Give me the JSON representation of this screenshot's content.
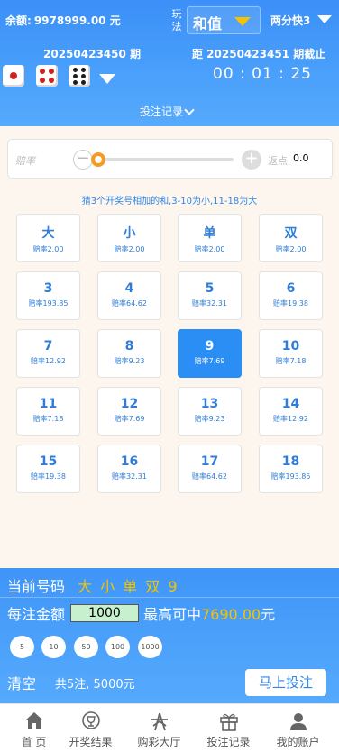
{
  "header": {
    "balance_label": "余额:",
    "balance_value": "9978999.00 元",
    "play_label": "玩法",
    "play_mode": "和值",
    "lottery_name": "两分快3",
    "current_period": "20250423450 期",
    "next_period_label": "距 20250423451 期截止",
    "countdown": "00 : 01 : 25",
    "dice": [
      1,
      4,
      6
    ],
    "record_button": "投注记录"
  },
  "rate_bar": {
    "rate_label": "赔率",
    "rebate_label": "返点",
    "rebate_value": "0.0",
    "minus": "−",
    "plus": "+"
  },
  "hint": "猜3个开奖号相加的和,3-10为小,11-18为大",
  "options": [
    {
      "name": "大",
      "odds": "赔率2.00",
      "selected": false
    },
    {
      "name": "小",
      "odds": "赔率2.00",
      "selected": false
    },
    {
      "name": "单",
      "odds": "赔率2.00",
      "selected": false
    },
    {
      "name": "双",
      "odds": "赔率2.00",
      "selected": false
    },
    {
      "name": "3",
      "odds": "赔率193.85",
      "selected": false
    },
    {
      "name": "4",
      "odds": "赔率64.62",
      "selected": false
    },
    {
      "name": "5",
      "odds": "赔率32.31",
      "selected": false
    },
    {
      "name": "6",
      "odds": "赔率19.38",
      "selected": false
    },
    {
      "name": "7",
      "odds": "赔率12.92",
      "selected": false
    },
    {
      "name": "8",
      "odds": "赔率9.23",
      "selected": false
    },
    {
      "name": "9",
      "odds": "赔率7.69",
      "selected": true
    },
    {
      "name": "10",
      "odds": "赔率7.18",
      "selected": false
    },
    {
      "name": "11",
      "odds": "赔率7.18",
      "selected": false
    },
    {
      "name": "12",
      "odds": "赔率7.69",
      "selected": false
    },
    {
      "name": "13",
      "odds": "赔率9.23",
      "selected": false
    },
    {
      "name": "14",
      "odds": "赔率12.92",
      "selected": false
    },
    {
      "name": "15",
      "odds": "赔率19.38",
      "selected": false
    },
    {
      "name": "16",
      "odds": "赔率32.31",
      "selected": false
    },
    {
      "name": "17",
      "odds": "赔率64.62",
      "selected": false
    },
    {
      "name": "18",
      "odds": "赔率193.85",
      "selected": false
    }
  ],
  "bet_panel": {
    "current_label": "当前号码",
    "current_value": "大 小 单 双 9",
    "amount_label": "每注金额",
    "amount_value": "1000",
    "max_win_label": "最高可中",
    "max_win_value": "7690.00",
    "max_win_unit": "元",
    "chips": [
      "5",
      "10",
      "50",
      "100",
      "1000"
    ],
    "clear_label": "清空",
    "summary": "共5注, 5000元",
    "place_bet_label": "马上投注"
  },
  "tabbar": [
    {
      "label": "首 页",
      "icon": "home-icon"
    },
    {
      "label": "开奖结果",
      "icon": "trophy-icon"
    },
    {
      "label": "购彩大厅",
      "icon": "lobby-icon"
    },
    {
      "label": "投注记录",
      "icon": "gift-icon"
    },
    {
      "label": "我的账户",
      "icon": "user-icon"
    }
  ]
}
